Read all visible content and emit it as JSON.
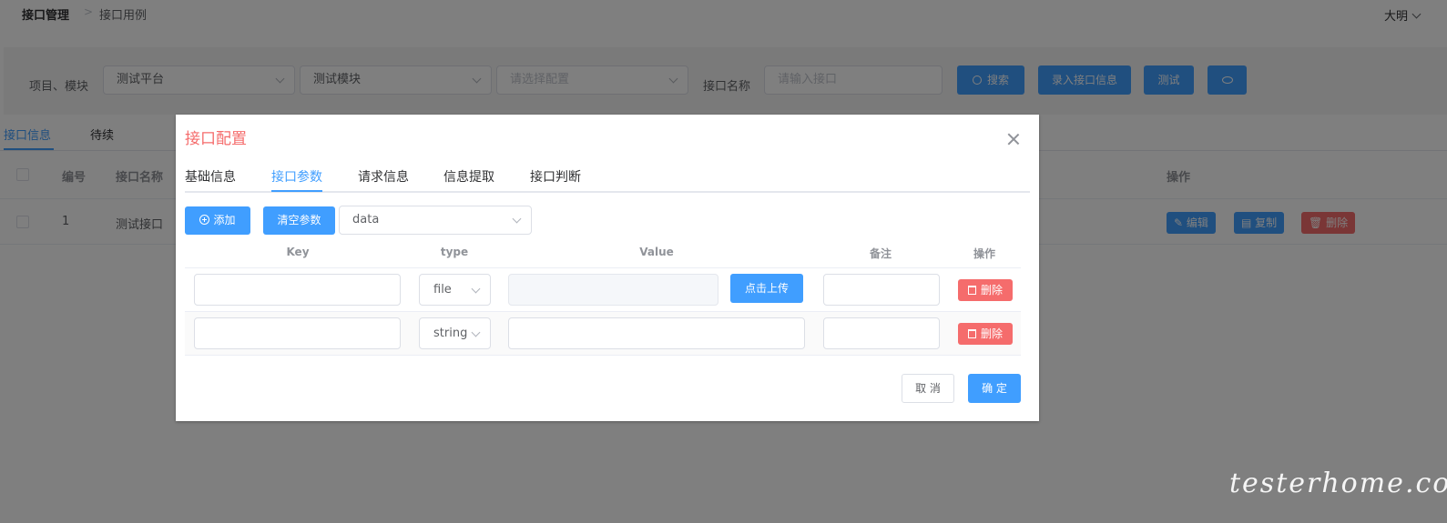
{
  "breadcrumb": {
    "root": "接口管理",
    "current": "接口用例"
  },
  "user": {
    "name": "大明"
  },
  "filters": {
    "project_module_label": "项目、模块",
    "project_value": "测试平台",
    "module_value": "测试模块",
    "config_placeholder": "请选择配置",
    "api_name_label": "接口名称",
    "api_name_placeholder": "请输入接口",
    "search_label": "搜索",
    "add_api_label": "录入接口信息",
    "test_label": "测试"
  },
  "page_tabs": [
    "接口信息",
    "待续"
  ],
  "table": {
    "headers": {
      "id": "编号",
      "name": "接口名称",
      "actions": "操作"
    },
    "rows": [
      {
        "id": "1",
        "name": "测试接口",
        "edit": "编辑",
        "copy": "复制",
        "delete": "删除"
      }
    ]
  },
  "dialog": {
    "title": "接口配置",
    "tabs": [
      "基础信息",
      "接口参数",
      "请求信息",
      "信息提取",
      "接口判断"
    ],
    "add_label": "添加",
    "clear_label": "清空参数",
    "body_type": "data",
    "param_headers": {
      "key": "Key",
      "type": "type",
      "value": "Value",
      "note": "备注",
      "action": "操作"
    },
    "params": [
      {
        "type": "file",
        "upload_label": "点击上传",
        "delete_label": "删除"
      },
      {
        "type": "string",
        "delete_label": "删除"
      }
    ],
    "cancel_label": "取 消",
    "ok_label": "确 定"
  },
  "watermark": "testerhome.com",
  "colors": {
    "primary": "#409eff",
    "danger": "#f56c6c",
    "title": "#f56c6c"
  }
}
